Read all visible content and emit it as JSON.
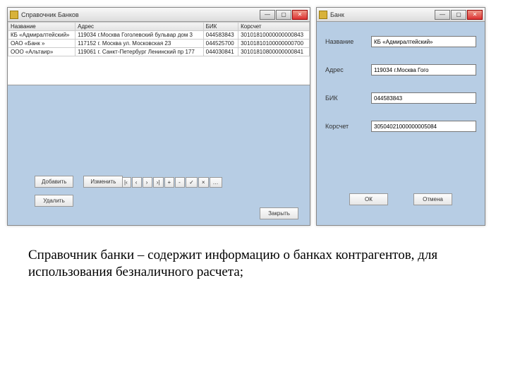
{
  "left_window": {
    "title": "Справочник Банков",
    "columns": [
      "Название",
      "Адрес",
      "БИК",
      "Корсчет"
    ],
    "rows": [
      [
        "КБ «Адмиралтейский»",
        "119034 г.Москва Гоголевский бульвар дом 3",
        "044583843",
        "30101810000000000843"
      ],
      [
        "ОАО «Банк »",
        "117152 г. Москва ул. Московская 23",
        "044525700",
        "30101810100000000700"
      ],
      [
        "ООО «Альтаир»",
        "119061 г. Санкт-Петербург Ленинский пр 177",
        "044030841",
        "30101810800000000841"
      ]
    ],
    "nav": [
      "|‹",
      "‹",
      "›",
      "›|",
      "+",
      "-",
      "✓",
      "×",
      "…"
    ],
    "btn_add": "Добавить",
    "btn_edit": "Изменить",
    "btn_del": "Удалить",
    "btn_close": "Закрыть"
  },
  "right_window": {
    "title": "Банк",
    "labels": {
      "name": "Название",
      "addr": "Адрес",
      "bik": "БИК",
      "kor": "Корсчет"
    },
    "values": {
      "name": "КБ «Адмиралтейский»",
      "addr": "119034 г.Москва Гого",
      "bik": "044583843",
      "kor": "30504021000000005084"
    },
    "ok": "ОК",
    "cancel": "Отмена"
  },
  "caption": "Справочник банки – содержит информацию о банках контрагентов, для использования безналичного расчета;"
}
